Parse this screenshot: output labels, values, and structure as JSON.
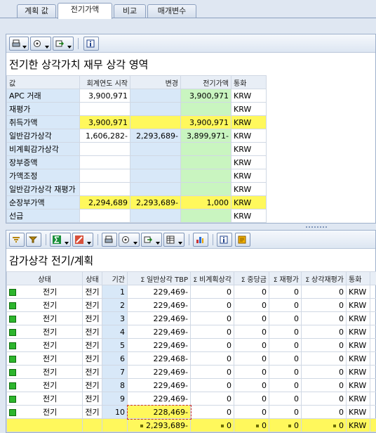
{
  "tabs": [
    {
      "label": "계획 값"
    },
    {
      "label": "전기가액"
    },
    {
      "label": "비교"
    },
    {
      "label": "매개변수"
    }
  ],
  "top_panel": {
    "title": "전기한 상각가치 재무 상각 영역",
    "columns": {
      "label": "값",
      "fy_start": "회계연도 시작",
      "change": "변경",
      "posted": "전기가액",
      "currency": "통화"
    },
    "rows": [
      {
        "label": "APC 거래",
        "fy_start": "3,900,971",
        "change": "",
        "posted": "3,900,971",
        "currency": "KRW"
      },
      {
        "label": "재평가",
        "fy_start": "",
        "change": "",
        "posted": "",
        "currency": "KRW"
      },
      {
        "label": "취득가액",
        "fy_start": "3,900,971",
        "change": "",
        "posted": "3,900,971",
        "currency": "KRW"
      },
      {
        "label": "일반감가상각",
        "fy_start": "1,606,282-",
        "change": "2,293,689-",
        "posted": "3,899,971-",
        "currency": "KRW"
      },
      {
        "label": "비계획감가상각",
        "fy_start": "",
        "change": "",
        "posted": "",
        "currency": "KRW"
      },
      {
        "label": "장부증액",
        "fy_start": "",
        "change": "",
        "posted": "",
        "currency": "KRW"
      },
      {
        "label": "가액조정",
        "fy_start": "",
        "change": "",
        "posted": "",
        "currency": "KRW"
      },
      {
        "label": "일반감가상각 재평가",
        "fy_start": "",
        "change": "",
        "posted": "",
        "currency": "KRW"
      },
      {
        "label": "순장부가액",
        "fy_start": "2,294,689",
        "change": "2,293,689-",
        "posted": "1,000",
        "currency": "KRW"
      },
      {
        "label": "선급",
        "fy_start": "",
        "change": "",
        "posted": "",
        "currency": "KRW"
      }
    ]
  },
  "bottom_panel": {
    "title": "감가상각 전기/계획",
    "columns": {
      "status": "상태",
      "state": "상태",
      "period": "기간",
      "ordinary": "일반상각 TBP",
      "unplanned": "비계획상각",
      "special": "중당금",
      "reval": "재평가",
      "reval_dep": "상각재평가",
      "currency": "통화"
    },
    "rows": [
      {
        "status": "전기",
        "state": "전기",
        "period": "1",
        "ordinary": "229,469-",
        "unplanned": "0",
        "special": "0",
        "reval": "0",
        "reval_dep": "0",
        "currency": "KRW"
      },
      {
        "status": "전기",
        "state": "전기",
        "period": "2",
        "ordinary": "229,469-",
        "unplanned": "0",
        "special": "0",
        "reval": "0",
        "reval_dep": "0",
        "currency": "KRW"
      },
      {
        "status": "전기",
        "state": "전기",
        "period": "3",
        "ordinary": "229,469-",
        "unplanned": "0",
        "special": "0",
        "reval": "0",
        "reval_dep": "0",
        "currency": "KRW"
      },
      {
        "status": "전기",
        "state": "전기",
        "period": "4",
        "ordinary": "229,469-",
        "unplanned": "0",
        "special": "0",
        "reval": "0",
        "reval_dep": "0",
        "currency": "KRW"
      },
      {
        "status": "전기",
        "state": "전기",
        "period": "5",
        "ordinary": "229,469-",
        "unplanned": "0",
        "special": "0",
        "reval": "0",
        "reval_dep": "0",
        "currency": "KRW"
      },
      {
        "status": "전기",
        "state": "전기",
        "period": "6",
        "ordinary": "229,468-",
        "unplanned": "0",
        "special": "0",
        "reval": "0",
        "reval_dep": "0",
        "currency": "KRW"
      },
      {
        "status": "전기",
        "state": "전기",
        "period": "7",
        "ordinary": "229,469-",
        "unplanned": "0",
        "special": "0",
        "reval": "0",
        "reval_dep": "0",
        "currency": "KRW"
      },
      {
        "status": "전기",
        "state": "전기",
        "period": "8",
        "ordinary": "229,469-",
        "unplanned": "0",
        "special": "0",
        "reval": "0",
        "reval_dep": "0",
        "currency": "KRW"
      },
      {
        "status": "전기",
        "state": "전기",
        "period": "9",
        "ordinary": "229,469-",
        "unplanned": "0",
        "special": "0",
        "reval": "0",
        "reval_dep": "0",
        "currency": "KRW"
      },
      {
        "status": "전기",
        "state": "전기",
        "period": "10",
        "ordinary": "228,469-",
        "unplanned": "0",
        "special": "0",
        "reval": "0",
        "reval_dep": "0",
        "currency": "KRW"
      }
    ],
    "totals": {
      "ordinary": "2,293,689-",
      "unplanned": "0",
      "special": "0",
      "reval": "0",
      "reval_dep": "0",
      "currency": "KRW"
    }
  },
  "colors": {
    "yellow": "#fff85c",
    "green": "#c9f5c0",
    "label_blue": "#d8e8f8",
    "status_green": "#2db52d"
  }
}
